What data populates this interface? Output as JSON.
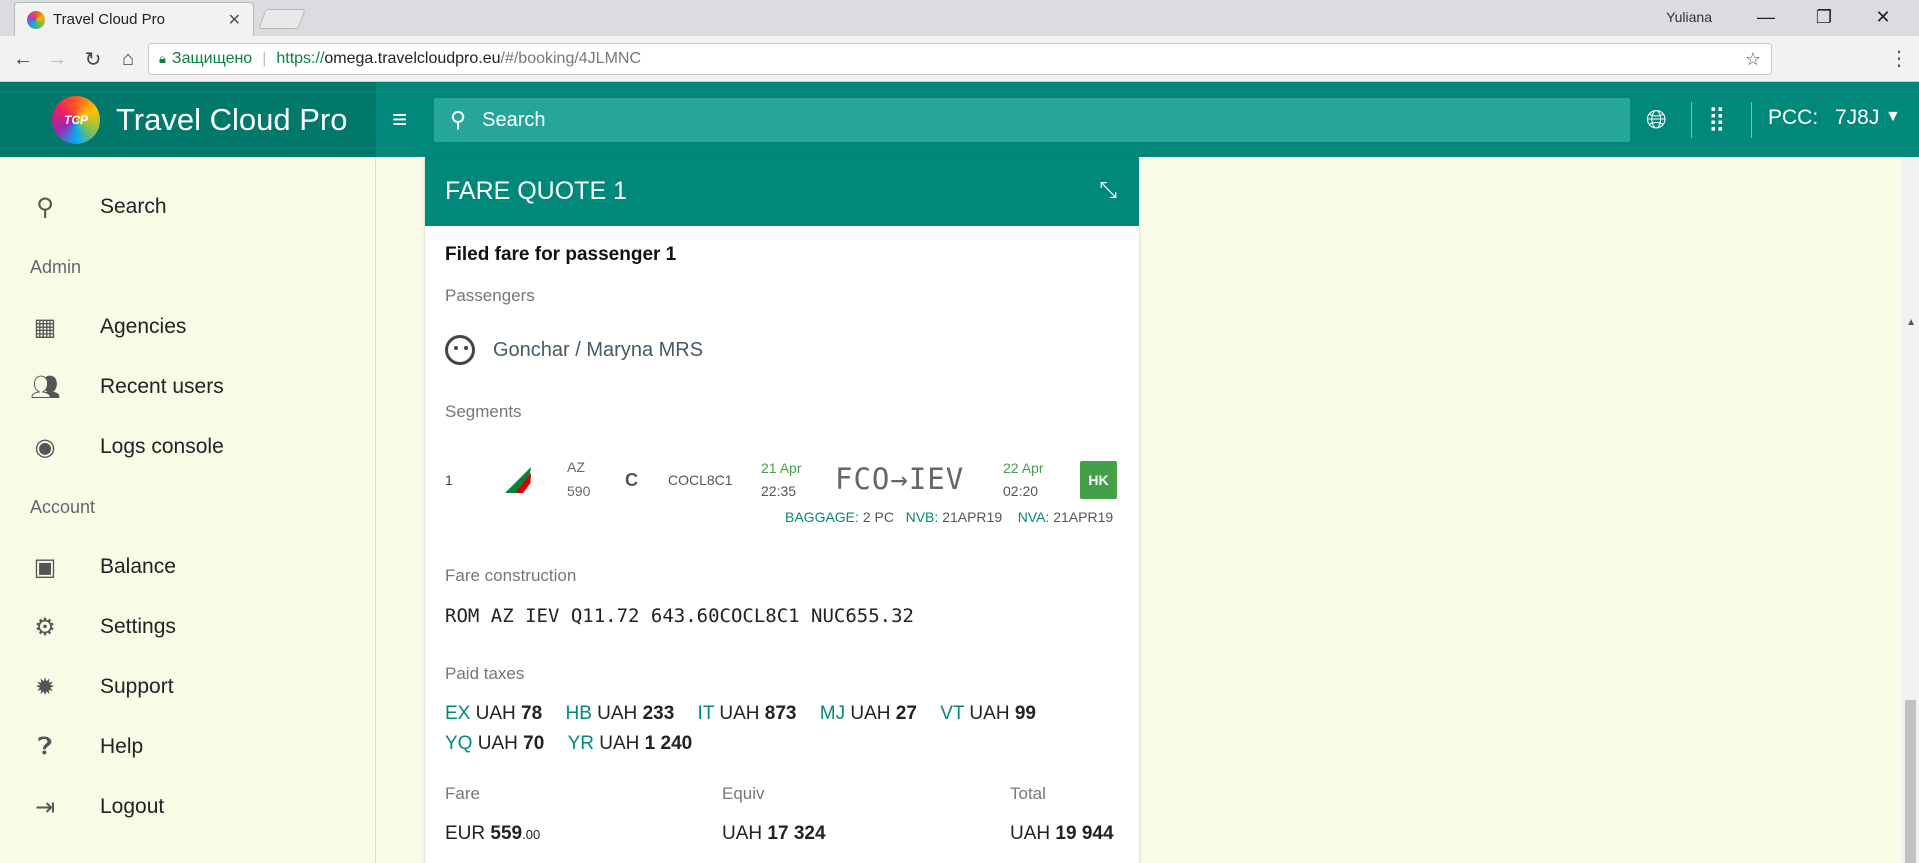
{
  "browser": {
    "tab_title": "Travel Cloud Pro",
    "tab_close": "✕",
    "user_name": "Yuliana",
    "secure_label": "Защищено",
    "url_proto": "https://",
    "url_host": "omega.travelcloudpro.eu",
    "url_path": "/#/booking/4JLMNC"
  },
  "app": {
    "logo_text": "TCP",
    "brand_name": "Travel Cloud Pro",
    "search_placeholder": "Search",
    "pcc_label": "PCC:",
    "pcc_value": "7J8J"
  },
  "sidebar": {
    "items": [
      {
        "label": "Search",
        "icon": "search-icon"
      },
      {
        "label": "Agencies",
        "icon": "building-icon"
      },
      {
        "label": "Recent users",
        "icon": "people-icon"
      },
      {
        "label": "Logs console",
        "icon": "compass-icon"
      },
      {
        "label": "Balance",
        "icon": "wallet-icon"
      },
      {
        "label": "Settings",
        "icon": "gear-icon"
      },
      {
        "label": "Support",
        "icon": "bug-icon"
      },
      {
        "label": "Help",
        "icon": "help-icon"
      },
      {
        "label": "Logout",
        "icon": "logout-icon"
      }
    ],
    "sections": {
      "admin": "Admin",
      "account": "Account"
    }
  },
  "fare_quote": {
    "title": "FARE QUOTE 1",
    "heading": "Filed fare for passenger 1",
    "passengers_label": "Passengers",
    "passenger_name": "Gonchar / Maryna MRS",
    "segments_label": "Segments",
    "segment": {
      "number": "1",
      "carrier": "AZ",
      "flight": "590",
      "class": "C",
      "fare_basis": "COCL8C1",
      "dep_date": "21 Apr",
      "dep_time": "22:35",
      "route": "FCO→IEV",
      "arr_date": "22 Apr",
      "arr_time": "02:20",
      "status": "HK",
      "baggage_label": "BAGGAGE:",
      "baggage_value": "2 PC",
      "nvb_label": "NVB:",
      "nvb_value": "21APR19",
      "nva_label": "NVA:",
      "nva_value": "21APR19"
    },
    "fare_construction_label": "Fare construction",
    "fare_construction": "ROM AZ IEV Q11.72 643.60COCL8C1 NUC655.32",
    "paid_taxes_label": "Paid taxes",
    "taxes": [
      {
        "code": "EX",
        "currency": "UAH",
        "amount": "78"
      },
      {
        "code": "HB",
        "currency": "UAH",
        "amount": "233"
      },
      {
        "code": "IT",
        "currency": "UAH",
        "amount": "873"
      },
      {
        "code": "MJ",
        "currency": "UAH",
        "amount": "27"
      },
      {
        "code": "VT",
        "currency": "UAH",
        "amount": "99"
      },
      {
        "code": "YQ",
        "currency": "UAH",
        "amount": "70"
      },
      {
        "code": "YR",
        "currency": "UAH",
        "amount": "1 240"
      }
    ],
    "fare_label": "Fare",
    "fare_currency": "EUR",
    "fare_amount": "559",
    "fare_cents": ".00",
    "equiv_label": "Equiv",
    "equiv_currency": "UAH",
    "equiv_amount": "17 324",
    "total_label": "Total",
    "total_currency": "UAH",
    "total_amount": "19 944"
  },
  "colors": {
    "primary": "#00897b",
    "primary_dark": "#00796b",
    "sidebar_bg": "#f9fbe7",
    "status_green": "#43a047"
  }
}
